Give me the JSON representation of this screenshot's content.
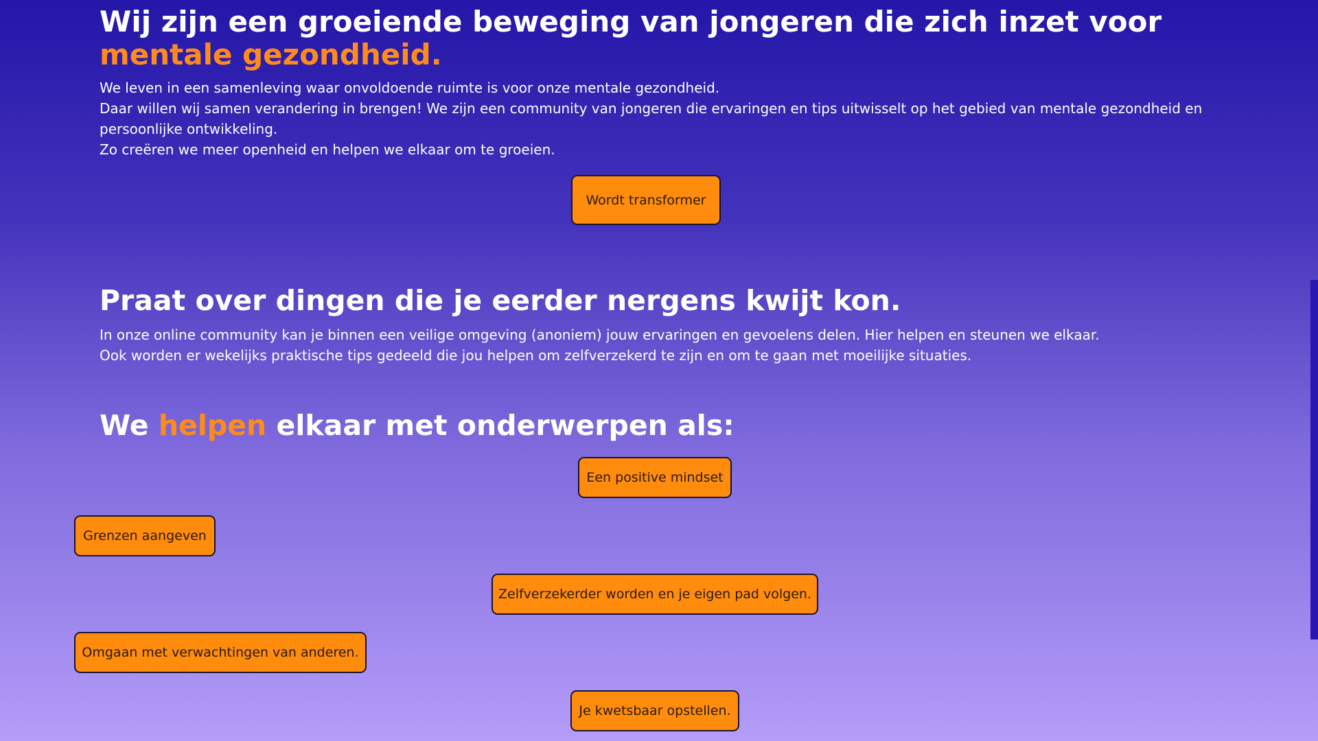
{
  "hero": {
    "title_main": "Wij zijn een groeiende beweging van jongeren die zich inzet voor ",
    "title_accent": "mentale gezondheid.",
    "paragraphs": [
      "We leven in een samenleving waar onvoldoende ruimte is voor onze mentale gezondheid.",
      "Daar willen wij samen verandering in brengen! We zijn een community van jongeren die ervaringen en tips uitwisselt op het gebied van mentale gezondheid en persoonlijke ontwikkeling.",
      "Zo creëren we meer openheid en helpen we elkaar om te groeien."
    ],
    "cta_label": "Wordt transformer"
  },
  "community": {
    "title": "Praat over dingen die je eerder nergens kwijt kon.",
    "paragraphs": [
      "In onze online community kan je binnen een veilige omgeving (anoniem) jouw ervaringen en gevoelens delen. Hier helpen en steunen we elkaar.",
      "Ook worden er wekelijks praktische tips gedeeld die jou helpen om zelfverzekerd te zijn en om te gaan met moeilijke situaties."
    ]
  },
  "topics": {
    "title_before": "We ",
    "title_accent": "helpen",
    "title_after": " elkaar met onderwerpen als:",
    "items": [
      "Een positive mindset",
      "Grenzen aangeven",
      "Zelfverzekerder worden en je eigen pad volgen.",
      "Omgaan met verwachtingen van anderen.",
      "Je kwetsbaar opstellen."
    ]
  },
  "colors": {
    "accent": "#ff8c1a",
    "button_bg": "#ff8c0d",
    "gradient_top": "#2416a8",
    "gradient_bottom": "#b49cf8"
  }
}
